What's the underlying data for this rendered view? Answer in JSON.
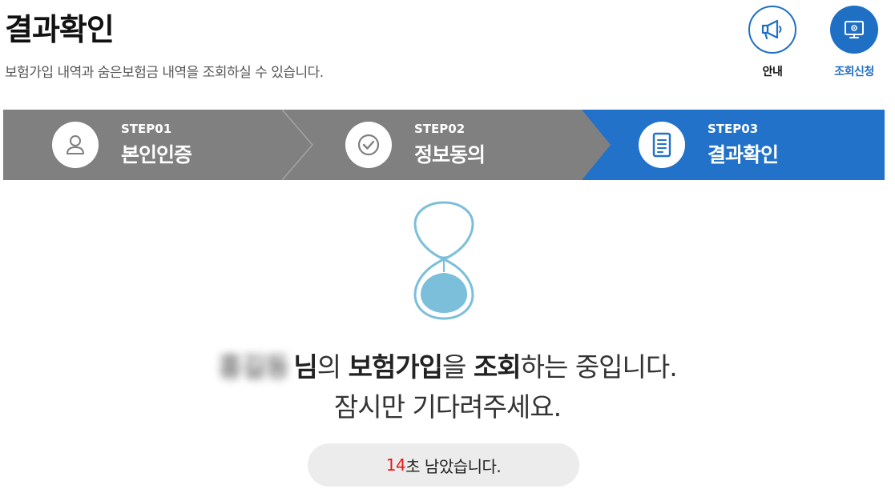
{
  "header": {
    "title": "결과확인",
    "subtitle": "보험가입 내역과 숨은보험금 내역을 조회하실 수 있습니다."
  },
  "top_actions": [
    {
      "label": "안내",
      "icon": "megaphone-icon"
    },
    {
      "label": "조회신청",
      "icon": "monitor-settings-icon"
    }
  ],
  "steps": [
    {
      "num": "STEP01",
      "name": "본인인증",
      "icon": "person-icon",
      "active": false
    },
    {
      "num": "STEP02",
      "name": "정보동의",
      "icon": "check-circle-icon",
      "active": false
    },
    {
      "num": "STEP03",
      "name": "결과확인",
      "icon": "document-icon",
      "active": true
    }
  ],
  "colors": {
    "accent": "#2272c9",
    "step_inactive": "#808080",
    "hourglass": "#7bbfdb",
    "countdown_number": "#e31b1b"
  },
  "message": {
    "user_name": "홍길동",
    "part1": "님",
    "part2": "의 ",
    "part3": "보험가입",
    "part4": "을 ",
    "part5": "조회",
    "part6": "하는 중입니다.",
    "line2": "잠시만 기다려주세요."
  },
  "countdown": {
    "seconds": "14",
    "suffix": "초 남았습니다."
  }
}
